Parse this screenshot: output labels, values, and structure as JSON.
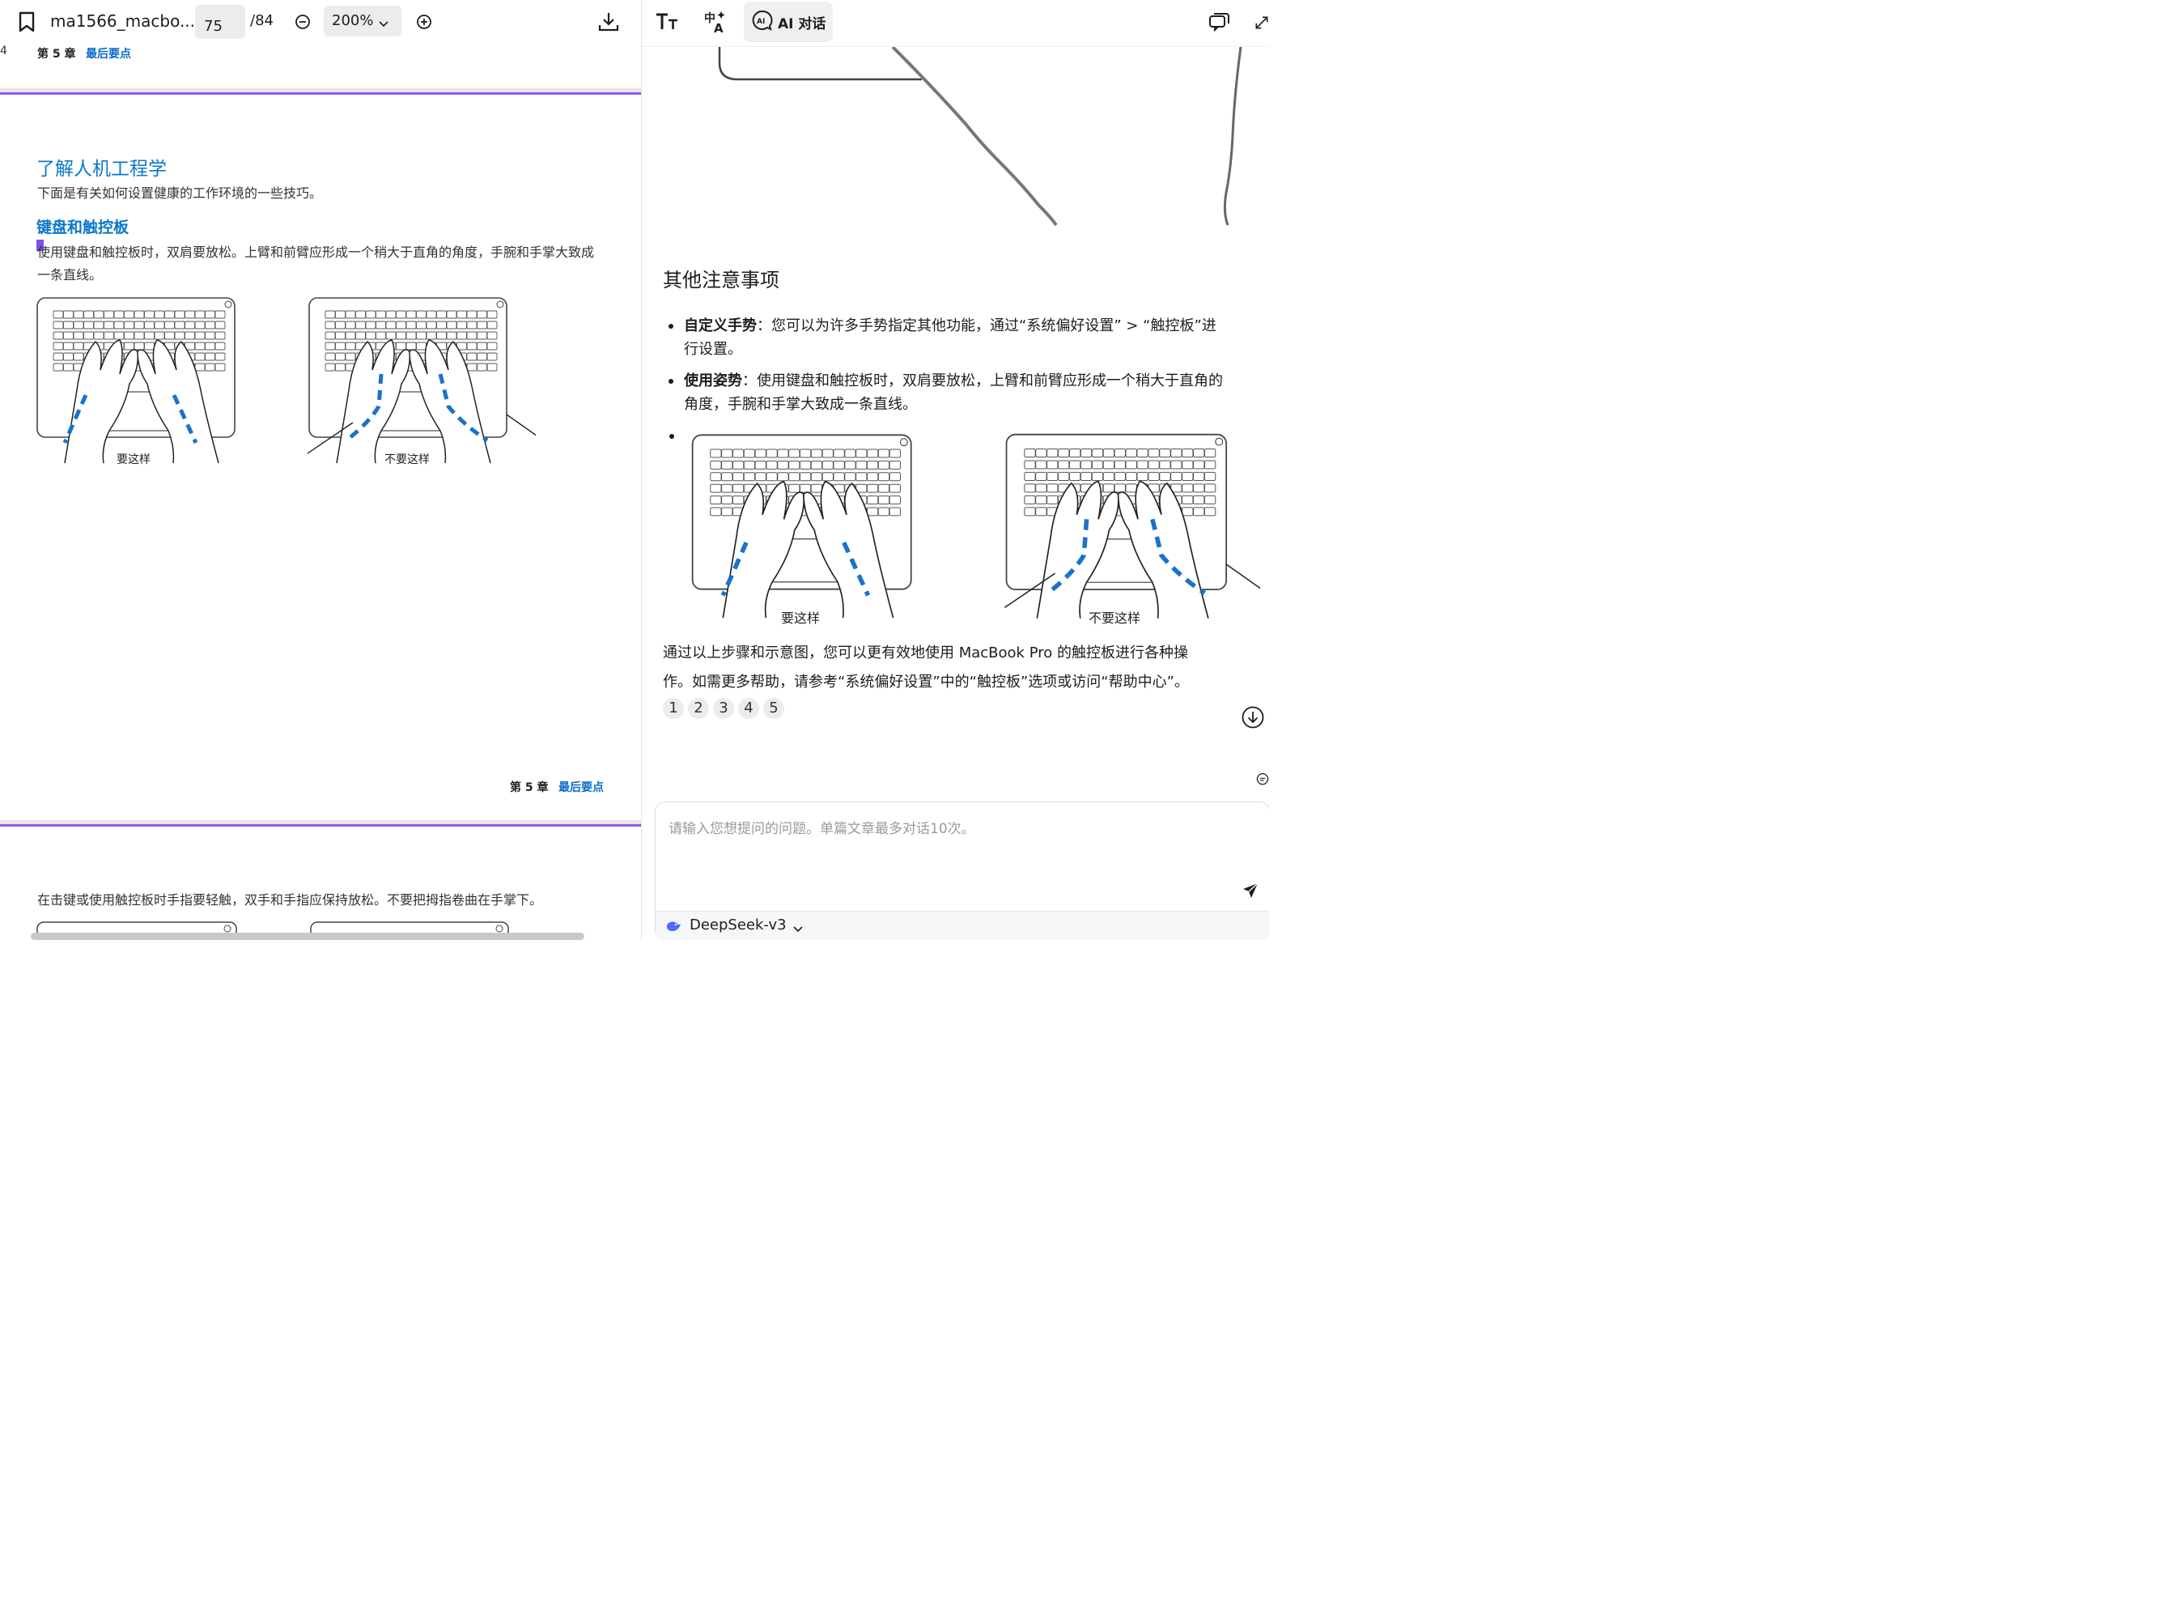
{
  "pdf_viewer": {
    "toolbar": {
      "doc_title": "ma1566_macbo...",
      "page_current": "75",
      "page_total": "/84",
      "zoom": "200%"
    },
    "page_top_partial": {
      "page_number": "4",
      "chapter": "第 5 章",
      "chapter_link": "最后要点"
    },
    "page": {
      "heading": "了解人机工程学",
      "intro": "下面是有关如何设置健康的工作环境的一些技巧。",
      "subheading": "键盘和触控板",
      "para_line1": "使用键盘和触控板时，双肩要放松。上臂和前臂应形成一个稍大于直角的角度，手腕和手掌大致成",
      "para_line2": "一条直线。",
      "caption_good": "要这样",
      "caption_bad": "不要这样",
      "footer_chapter": "第 5 章",
      "footer_link": "最后要点"
    },
    "next_page": {
      "text": "在击键或使用触控板时手指要轻触，双手和手指应保持放松。不要把拇指卷曲在手掌下。"
    }
  },
  "ai_panel": {
    "toolbar": {
      "ai_tab_label": "AI 对话"
    },
    "answer": {
      "section_title": "其他注意事项",
      "bullet1_bold": "自定义手势",
      "bullet1_line1": "：您可以为许多手势指定其他功能，通过“系统偏好设置” > “触控板”进",
      "bullet1_line2": "行设置。",
      "bullet2_bold": "使用姿势",
      "bullet2_line1": "：使用键盘和触控板时，双肩要放松，上臂和前臂应形成一个稍大于直角的",
      "bullet2_line2": "角度，手腕和手掌大致成一条直线。",
      "caption_good": "要这样",
      "caption_bad": "不要这样",
      "summary_line1": "通过以上步骤和示意图，您可以更有效地使用 MacBook Pro 的触控板进行各种操",
      "summary_line2": "作。如需更多帮助，请参考“系统偏好设置”中的“触控板”选项或访问“帮助中心”。",
      "citations": [
        "1",
        "2",
        "3",
        "4",
        "5"
      ]
    },
    "chat": {
      "placeholder": "请输入您想提问的问题。单篇文章最多对话10次。",
      "model": "DeepSeek-v3"
    }
  },
  "colors": {
    "link_blue": "#0b77c8",
    "page_separator": "#8a5cf0",
    "posture_dash": "#1a73c7"
  }
}
